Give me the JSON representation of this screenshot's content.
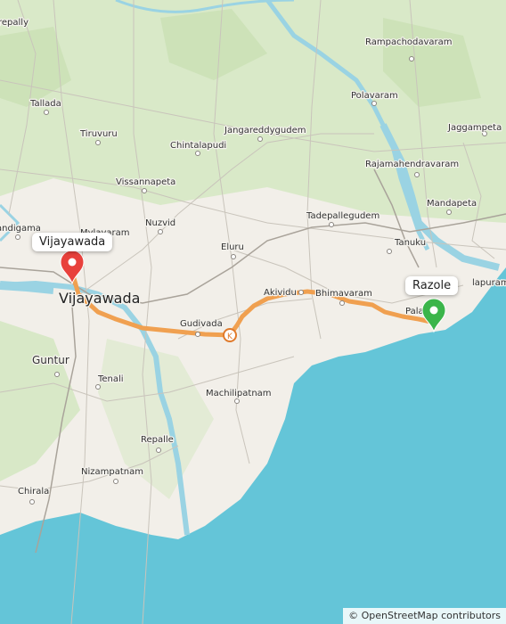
{
  "map": {
    "places": {
      "rampachodavaram": "Rampachodavaram",
      "repally": "repally",
      "tallada": "Tallada",
      "polavaram": "Polavaram",
      "tiruvuru": "Tiruvuru",
      "jangareddygudem": "Jangareddygudem",
      "jaggampeta": "Jaggampeta",
      "chintalapudi": "Chintalapudi",
      "rajamahendravaram": "Rajamahendravaram",
      "vissannapeta": "Vissannapeta",
      "mandapeta": "Mandapeta",
      "tadepallegudem": "Tadepallegudem",
      "nuzvid": "Nuzvid",
      "nandigama": "andigama",
      "mylavaram": "Mylavaram",
      "tanuku": "Tanuku",
      "eluru": "Eluru",
      "amalapuram": "lapuram",
      "vijayawada": "Vijayawada",
      "akividu": "Akividu",
      "bhimavaram": "Bhimavaram",
      "palakollu": "Pala",
      "gudivada": "Gudivada",
      "guntur": "Guntur",
      "tenali": "Tenali",
      "machilipatnam": "Machilipatnam",
      "repalle": "Repalle",
      "nizampatnam": "Nizampatnam",
      "chirala": "Chirala"
    },
    "markers": {
      "start": {
        "label": "Vijayawada",
        "color": "#e8413c"
      },
      "end": {
        "label": "Razole",
        "color": "#3bb54a"
      }
    },
    "route_color": "#f0a050",
    "attribution": "© OpenStreetMap contributors"
  }
}
